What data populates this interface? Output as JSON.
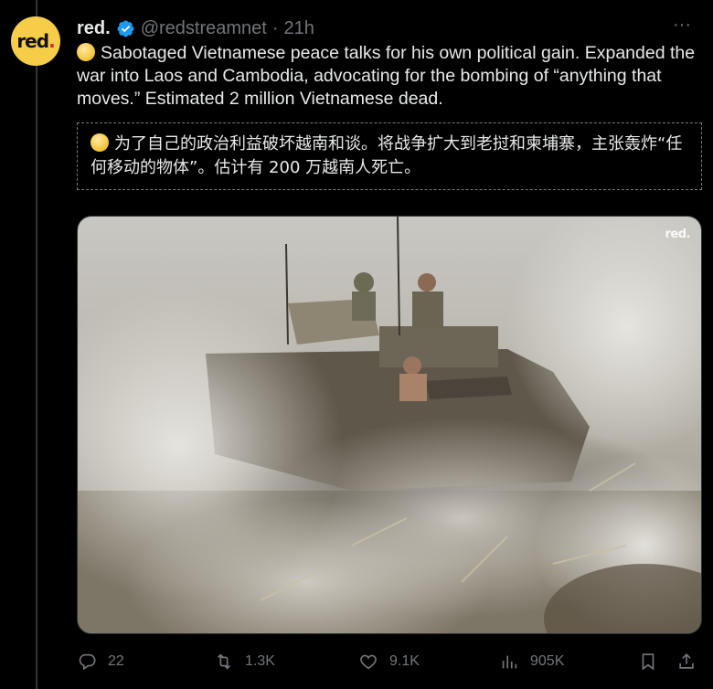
{
  "tweet": {
    "avatar_text": "red",
    "avatar_dot": ".",
    "name": "red.",
    "handle": "@redstreamnet",
    "separator": "·",
    "time": "21h",
    "more": "···",
    "text": "Sabotaged Vietnamese peace talks for his own political gain. Expanded the war into Laos and Cambodia, advocating for the bombing of “anything that moves.” Estimated 2 million Vietnamese dead.",
    "translation": "为了自己的政治利益破坏越南和谈。将战争扩大到老挝和柬埔寨，主张轰炸“任何移动的物体”。估计有 200 万越南人死亡。",
    "media_watermark": "red."
  },
  "actions": {
    "replies": "22",
    "reposts": "1.3K",
    "likes": "9.1K",
    "views": "905K"
  },
  "icons": {
    "verified": "verified-badge-icon",
    "reply": "reply-icon",
    "repost": "repost-icon",
    "like": "heart-icon",
    "views": "views-icon",
    "bookmark": "bookmark-icon",
    "share": "share-icon"
  },
  "colors": {
    "background": "#000000",
    "text": "#e7e9ea",
    "muted": "#71767b",
    "verified": "#1d9bf0",
    "avatar": "#f5cd48"
  }
}
